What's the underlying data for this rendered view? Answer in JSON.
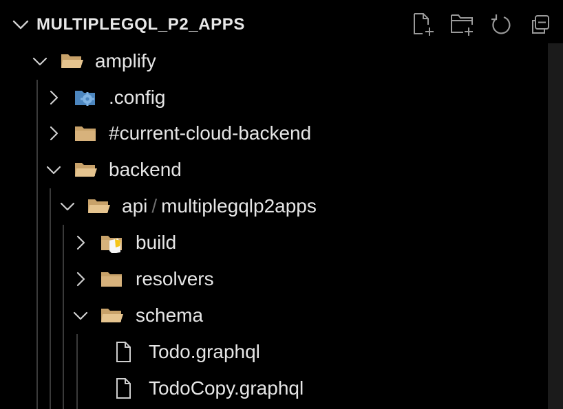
{
  "explorer": {
    "title": "MULTIPLEGQL_P2_APPS",
    "actions": [
      {
        "name": "new-file-icon"
      },
      {
        "name": "new-folder-icon"
      },
      {
        "name": "refresh-icon"
      },
      {
        "name": "collapse-all-icon"
      }
    ]
  },
  "tree": {
    "amplify": {
      "label": "amplify",
      "expanded": true,
      "icon": "folder-open-icon"
    },
    "config": {
      "label": ".config",
      "expanded": false,
      "icon": "config-folder-icon"
    },
    "current_cloud_backend": {
      "label": "#current-cloud-backend",
      "expanded": false,
      "icon": "folder-icon"
    },
    "backend": {
      "label": "backend",
      "expanded": true,
      "icon": "folder-open-icon"
    },
    "api": {
      "label_prefix": "api",
      "separator": "/",
      "label_suffix": "multiplegqlp2apps",
      "expanded": true,
      "icon": "folder-open-icon"
    },
    "build": {
      "label": "build",
      "expanded": false,
      "icon": "build-folder-icon"
    },
    "resolvers": {
      "label": "resolvers",
      "expanded": false,
      "icon": "folder-icon"
    },
    "schema": {
      "label": "schema",
      "expanded": true,
      "icon": "folder-open-icon"
    },
    "todo": {
      "label": "Todo.graphql",
      "icon": "file-icon"
    },
    "todocopy": {
      "label": "TodoCopy.graphql",
      "icon": "file-icon"
    }
  }
}
